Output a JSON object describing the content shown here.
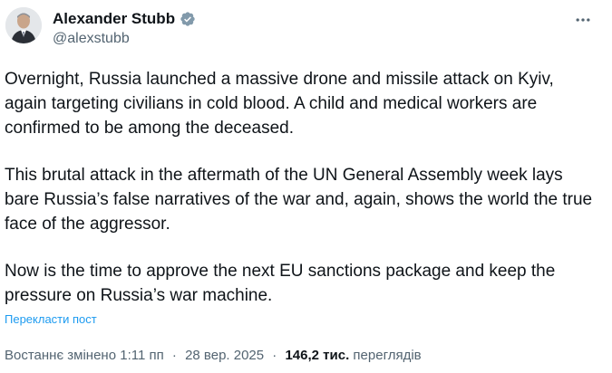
{
  "author": {
    "display_name": "Alexander Stubb",
    "handle": "@alexstubb",
    "verified_icon": "verified-badge-icon",
    "avatar_alt": "avatar"
  },
  "more_icon": "more-options-icon",
  "post": {
    "paragraphs": [
      "Overnight, Russia launched a massive drone and missile attack on Kyiv, again targeting civilians in cold blood. A child and medical workers are confirmed to be among the deceased.",
      "This brutal attack in the aftermath of the UN General Assembly week lays bare Russia’s false narratives of the war and, again, shows the world the true face of the aggressor.",
      "Now is the time to approve the next EU sanctions package and keep the pressure on Russia’s war machine."
    ],
    "translate_label": "Перекласти пост"
  },
  "meta": {
    "edited_label": "Востаннє змінено",
    "time": "1:11 пп",
    "separator": "·",
    "date": "28 вер. 2025",
    "views_count": "146,2 тис.",
    "views_label": "переглядів"
  },
  "colors": {
    "text": "#0f1419",
    "secondary": "#536471",
    "link": "#1d9bf0",
    "verified_badge": "#829aab"
  }
}
